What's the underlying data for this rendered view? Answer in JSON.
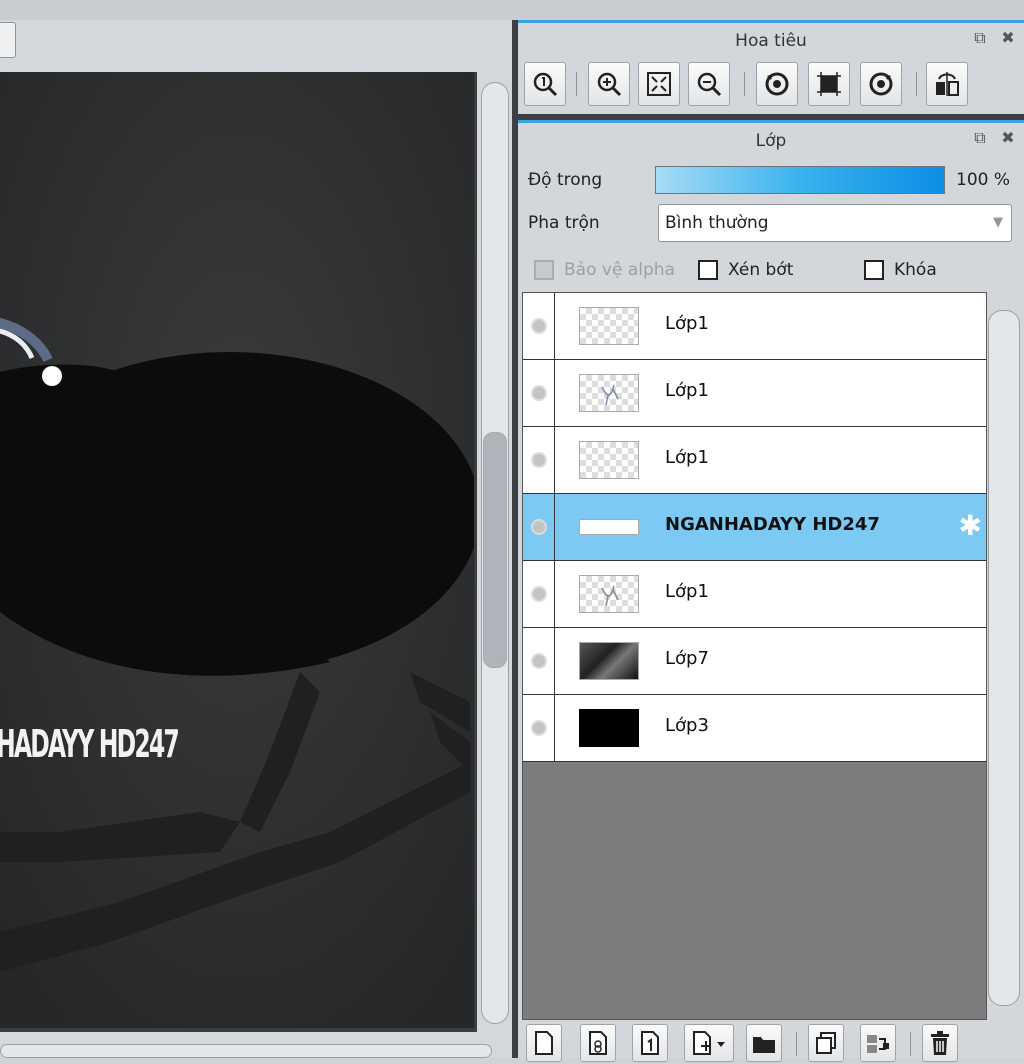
{
  "canvas": {
    "caption": "HADAYY HD247"
  },
  "navigator": {
    "title": "Hoa tiêu",
    "undock_icon": "⧉",
    "close_icon": "✖",
    "tools": [
      {
        "icon": "zoom-actual-icon"
      },
      {
        "icon": "zoom-in-icon"
      },
      {
        "icon": "fit-window-icon"
      },
      {
        "icon": "zoom-out-icon"
      },
      {
        "icon": "rotate-left-icon"
      },
      {
        "icon": "reset-view-icon"
      },
      {
        "icon": "rotate-right-icon"
      },
      {
        "icon": "flip-horizontal-icon"
      }
    ]
  },
  "layers": {
    "title": "Lớp",
    "undock_icon": "⧉",
    "close_icon": "✖",
    "opacity_label": "Độ trong",
    "opacity_value": "100 %",
    "opacity_fraction": 1.0,
    "blend_label": "Pha trộn",
    "blend_value": "Bình thường",
    "blend_arrow": "▼",
    "protect_alpha_label": "Bảo vệ alpha",
    "clipping_label": "Xén bớt",
    "lock_label": "Khóa",
    "gear_glyph": "✱",
    "items": [
      {
        "name": "Lớp1",
        "thumb": "checker"
      },
      {
        "name": "Lớp1",
        "thumb": "sketch"
      },
      {
        "name": "Lớp1",
        "thumb": "checker"
      },
      {
        "name": "NGANHADAYY HD247",
        "thumb": "text",
        "selected": true
      },
      {
        "name": "Lớp1",
        "thumb": "sketch"
      },
      {
        "name": "Lớp7",
        "thumb": "photo"
      },
      {
        "name": "Lớp3",
        "thumb": "black"
      }
    ],
    "toolbar": [
      {
        "icon": "new-layer-icon"
      },
      {
        "icon": "new-8bit-layer-icon"
      },
      {
        "icon": "new-1bit-layer-icon"
      },
      {
        "icon": "add-layer-dropdown-icon"
      },
      {
        "icon": "new-folder-icon"
      },
      {
        "icon": "duplicate-layer-icon"
      },
      {
        "icon": "merge-down-icon"
      },
      {
        "icon": "delete-layer-icon"
      }
    ]
  },
  "colors": {
    "accent": "#3aa0e6",
    "selected_row": "#7ccaf3",
    "canvas_bg": "#2a2b2c"
  }
}
